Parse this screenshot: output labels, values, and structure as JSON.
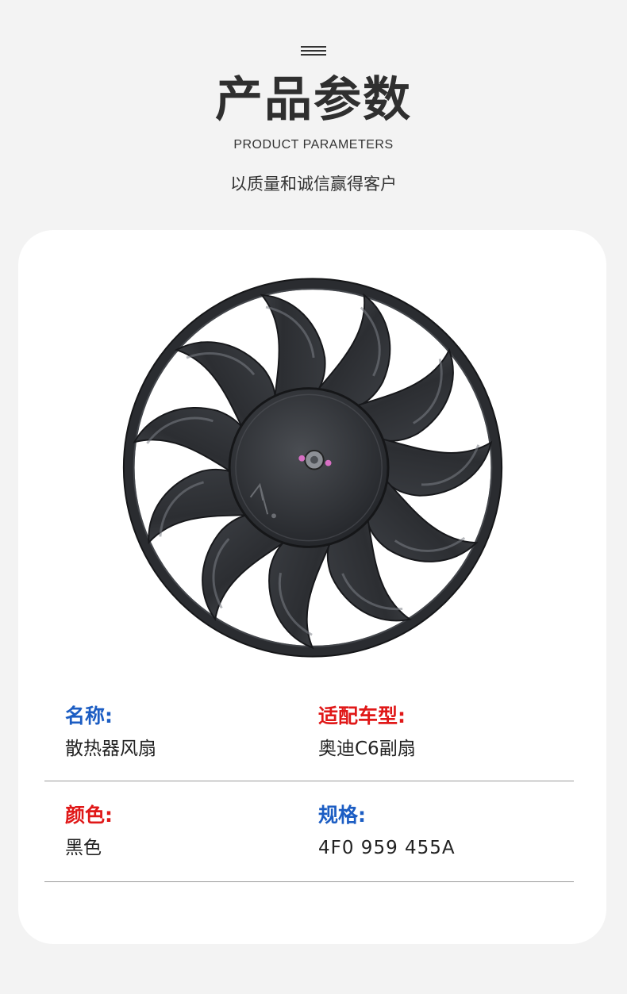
{
  "header": {
    "title": "产品参数",
    "subtitle": "PRODUCT PARAMETERS",
    "tagline": "以质量和诚信赢得客户"
  },
  "product": {
    "image_icon": "radiator-fan-image"
  },
  "specs": [
    {
      "label": "名称:",
      "value": "散热器风扇",
      "label_color": "#1c5dc3"
    },
    {
      "label": "适配车型:",
      "value": "奥迪C6副扇",
      "label_color": "#e01818"
    },
    {
      "label": "颜色:",
      "value": "黑色",
      "label_color": "#e01818"
    },
    {
      "label": "规格:",
      "value": "4F0 959 455A",
      "label_color": "#1c5dc3"
    }
  ],
  "colors": {
    "background": "#f3f3f3",
    "card": "#ffffff",
    "accent_blue": "#1c5dc3",
    "accent_red": "#e01818"
  }
}
